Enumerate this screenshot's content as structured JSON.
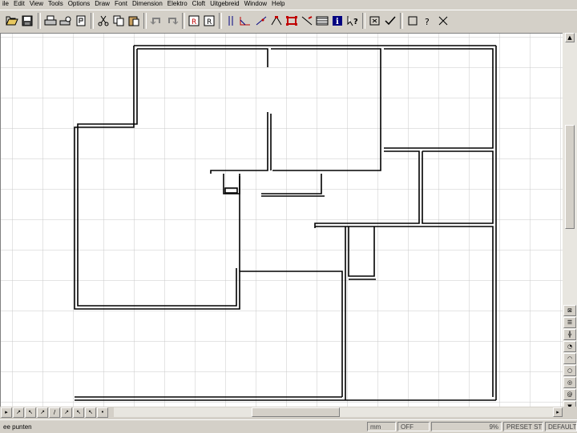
{
  "menu": [
    "ile",
    "Edit",
    "View",
    "Tools",
    "Options",
    "Draw",
    "Font",
    "Dimension",
    "Elektro",
    "Cloft",
    "Uitgebreid",
    "Window",
    "Help"
  ],
  "toolbar": {
    "icons": [
      "open-folder-icon",
      "save-icon",
      "print-icon",
      "print-preview-icon",
      "page-setup-icon",
      "cut-icon",
      "copy-icon",
      "paste-icon",
      "undo-icon",
      "redo-icon",
      "snap-grid-icon",
      "snap-point-icon",
      "parallel-icon",
      "angle-icon",
      "draw-line-icon",
      "node-edit-icon",
      "select-box-icon",
      "trim-icon",
      "list-icon",
      "info-icon",
      "help-pointer-icon",
      "zoom-window-icon",
      "check-icon",
      "rectangle-icon",
      "question-icon",
      "close-icon"
    ]
  },
  "right_tools": [
    "zoom-in-icon",
    "properties-icon",
    "grid-toggle-icon",
    "circle-arc-icon",
    "arc-icon",
    "circle-icon",
    "ellipse-icon",
    "spiral-icon",
    "scroll-down-icon"
  ],
  "bottom_tools": [
    "▸",
    "↗",
    "↖",
    "↗",
    "/",
    "↗",
    "↖",
    "↖",
    "•"
  ],
  "status": {
    "message": "ee punten",
    "unit": "mm",
    "mode": "OFF",
    "zoom": "9%",
    "preset": "PRESET ST",
    "layer": "DEFAULT"
  }
}
